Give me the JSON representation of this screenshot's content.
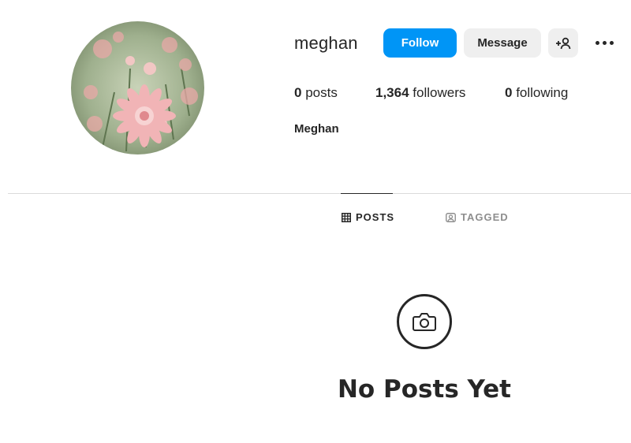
{
  "profile": {
    "username": "meghan",
    "full_name": "Meghan",
    "avatar_icon": "flower-photo"
  },
  "actions": {
    "follow_label": "Follow",
    "message_label": "Message",
    "add_user_icon": "add-user-icon",
    "more_icon": "more-icon"
  },
  "stats": {
    "posts_count": "0",
    "posts_label": " posts",
    "followers_count": "1,364",
    "followers_label": " followers",
    "following_count": "0",
    "following_label": " following"
  },
  "tabs": [
    {
      "label": "POSTS",
      "icon": "grid-icon",
      "active": true
    },
    {
      "label": "TAGGED",
      "icon": "tag-person-icon",
      "active": false
    }
  ],
  "empty_state": {
    "icon": "camera-icon",
    "title": "No Posts Yet"
  },
  "colors": {
    "accent": "#0095f6",
    "button_bg": "#efefef",
    "text": "#262626",
    "muted": "#8e8e8e",
    "divider": "#dbdbdb"
  }
}
